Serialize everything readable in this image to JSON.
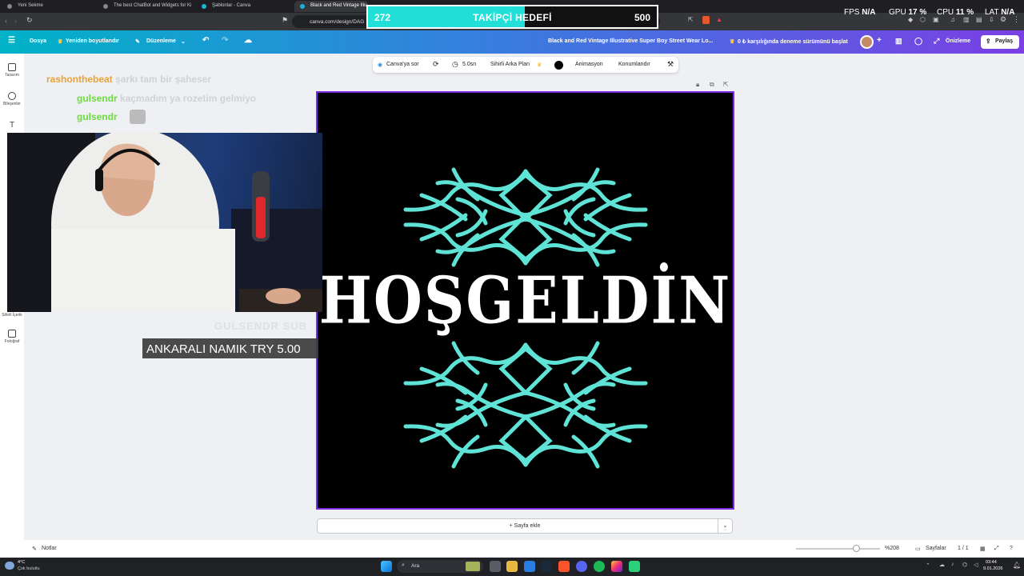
{
  "browser": {
    "tabs": [
      {
        "title": "Yeni Sekme"
      },
      {
        "title": "The best ChatBot and Widgets for Ki"
      },
      {
        "title": "Şablonlar - Canva"
      },
      {
        "title": "Black and Red Vintage Illu"
      }
    ],
    "url": "canva.com/design/DAG"
  },
  "follower_goal": {
    "current": "272",
    "title": "TAKİPÇİ HEDEFİ",
    "target": "500",
    "progress_fraction": 0.544
  },
  "stats": [
    {
      "label": "FPS",
      "value": "N/A"
    },
    {
      "label": "GPU",
      "value": "17 %"
    },
    {
      "label": "CPU",
      "value": "11 %"
    },
    {
      "label": "LAT",
      "value": "N/A"
    }
  ],
  "canva_header": {
    "file": "Dosya",
    "resize": "Yeniden boyutlandır",
    "edit": "Düzenleme",
    "doc_title": "Black and Red Vintage Illustrative Super Boy Street Wear Lo...",
    "trial": "0 ₺ karşılığında deneme sürümünü başlat",
    "preview": "Önizleme",
    "share": "Paylaş"
  },
  "sidebar": {
    "items": [
      {
        "label": "Tasarım",
        "icon": "layout-icon"
      },
      {
        "label": "Bileşenler",
        "icon": "elements-icon"
      },
      {
        "label": "",
        "icon": "text-icon"
      },
      {
        "label": "Sihirli İçerik",
        "icon": "magic-icon"
      },
      {
        "label": "Fotoğraf",
        "icon": "photo-icon"
      }
    ]
  },
  "context_toolbar": {
    "ask": "Canva'ya sor",
    "duration": "5.0sn",
    "bg_magic": "Sihirli Arka Plan",
    "animation": "Animasyon",
    "position": "Konumlandır"
  },
  "design": {
    "text": "HOŞGELDİN",
    "ornament_color": "#5fe3d6"
  },
  "add_page": "+ Sayfa ekle",
  "bottom_bar": {
    "notes": "Notlar",
    "zoom": "%208",
    "pages_label": "Sayfalar",
    "page_count": "1 / 1"
  },
  "chat": [
    {
      "user": "rashonthebeat",
      "message": "şarkı tam bir şaheser",
      "color": "#e8a23a"
    },
    {
      "user": "gulsendr",
      "message": "kaçmadım ya rozetim gelmiyo",
      "color": "#6ddc3c"
    },
    {
      "user": "gulsendr",
      "message": "",
      "color": "#6ddc3c"
    }
  ],
  "ghost_text": "GULSENDR  SUB",
  "donation_alert": "ANKARALI NAMIK  TRY 5.00",
  "taskbar": {
    "weather_temp": "4°C",
    "weather_text": "Çok bulutlu",
    "search": "Ara",
    "time": "03:44",
    "date": "9.01.2026"
  }
}
